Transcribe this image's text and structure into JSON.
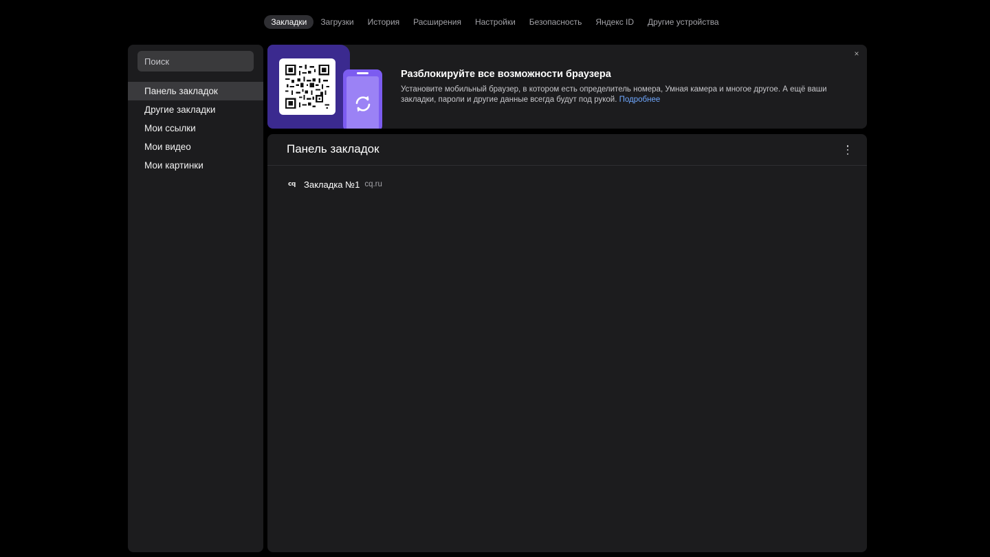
{
  "nav": {
    "tabs": [
      {
        "label": "Закладки",
        "active": true
      },
      {
        "label": "Загрузки"
      },
      {
        "label": "История"
      },
      {
        "label": "Расширения"
      },
      {
        "label": "Настройки"
      },
      {
        "label": "Безопасность"
      },
      {
        "label": "Яндекс ID"
      },
      {
        "label": "Другие устройства"
      }
    ]
  },
  "sidebar": {
    "search_placeholder": "Поиск",
    "items": [
      {
        "label": "Панель закладок",
        "active": true
      },
      {
        "label": "Другие закладки"
      },
      {
        "label": "Мои ссылки"
      },
      {
        "label": "Мои видео"
      },
      {
        "label": "Мои картинки"
      }
    ]
  },
  "banner": {
    "title": "Разблокируйте все возможности браузера",
    "description": "Установите мобильный браузер, в котором есть определитель номера, Умная камера и многое другое. А ещё ваши закладки, пароли и другие данные всегда будут под рукой.",
    "link": "Подробнее",
    "close_icon": "×",
    "colors": {
      "art_bg": "#3b2a8f",
      "phone": "#7c5cf0",
      "link": "#6fa8ff"
    }
  },
  "main": {
    "title": "Панель закладок",
    "bookmarks": [
      {
        "favicon": "cq",
        "name": "Закладка №1",
        "url": "cq.ru"
      }
    ]
  }
}
